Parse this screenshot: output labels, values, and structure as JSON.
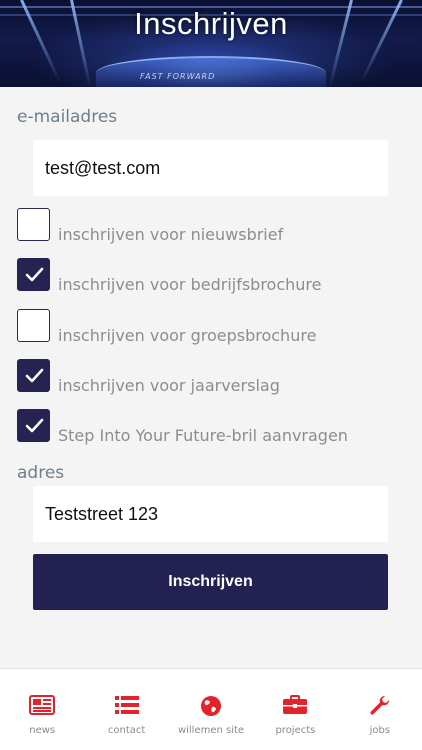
{
  "header": {
    "title": "Inschrijven",
    "stage_text": "FAST FORWARD"
  },
  "form": {
    "email_label": "e-mailadres",
    "email_value": "test@test.com",
    "options": [
      {
        "label": "inschrijven voor nieuwsbrief",
        "checked": false
      },
      {
        "label": "inschrijven voor bedrijfsbrochure",
        "checked": true
      },
      {
        "label": "inschrijven voor groepsbrochure",
        "checked": false
      },
      {
        "label": "inschrijven voor jaarverslag",
        "checked": true
      },
      {
        "label": "Step Into Your Future-bril aanvragen",
        "checked": true
      }
    ],
    "address_label": "adres",
    "address_value": "Teststreet 123",
    "submit_label": "Inschrijven"
  },
  "tabbar": {
    "items": [
      {
        "label": "news",
        "icon": "newspaper-icon"
      },
      {
        "label": "contact",
        "icon": "list-icon"
      },
      {
        "label": "willemen site",
        "icon": "globe-icon"
      },
      {
        "label": "projects",
        "icon": "briefcase-icon"
      },
      {
        "label": "jobs",
        "icon": "wrench-icon"
      }
    ]
  },
  "colors": {
    "accent": "#262352",
    "tab_icon": "#e3232b",
    "section_label": "#6d7f8f",
    "option_label": "#8d8d8d",
    "background": "#f4f4f4"
  }
}
